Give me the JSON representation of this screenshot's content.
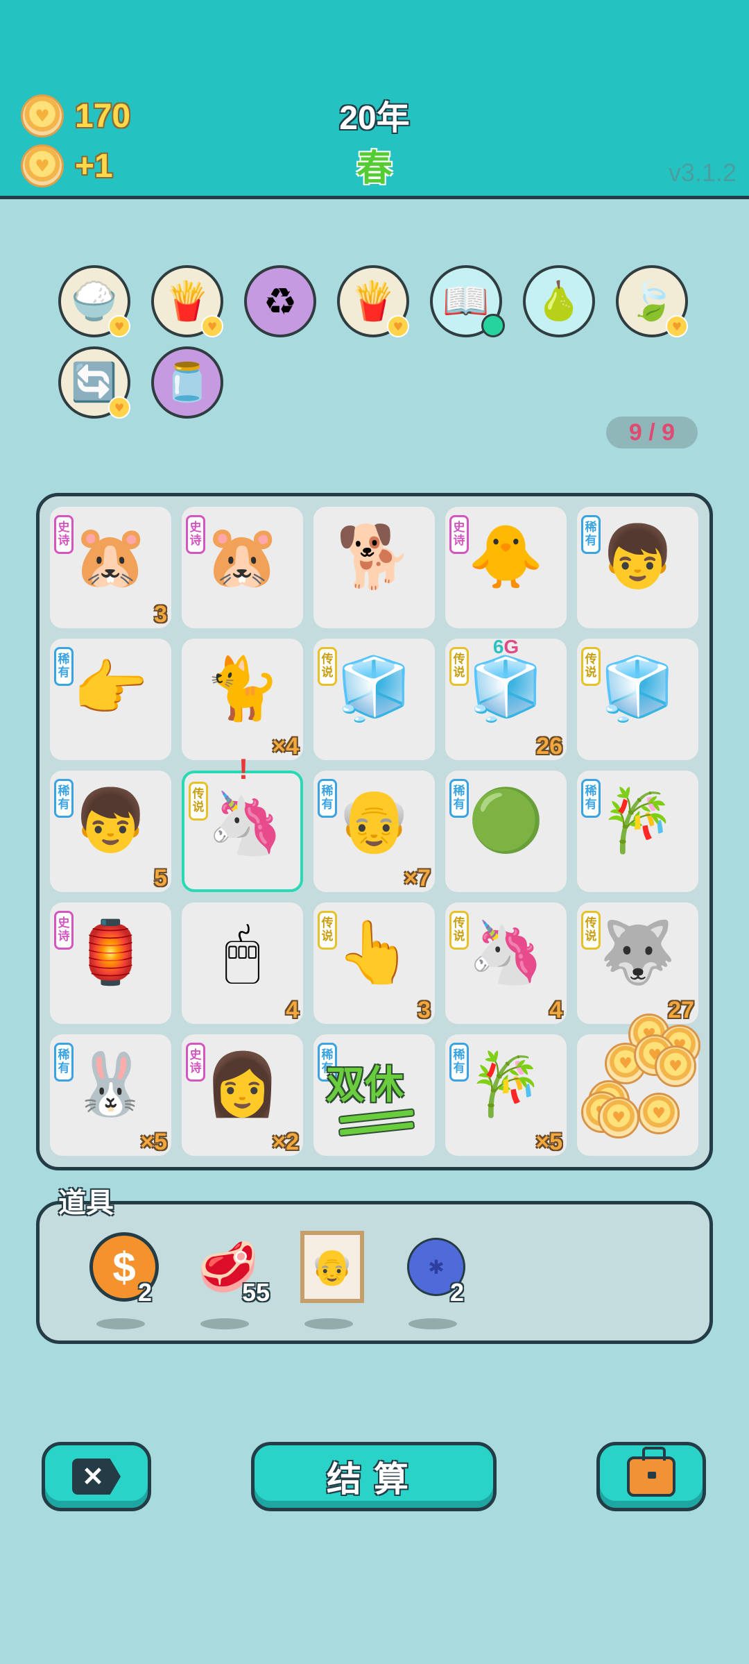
{
  "header": {
    "coins": "170",
    "income": "+1",
    "year": "20年",
    "season": "春",
    "version": "v3.1.2"
  },
  "toolbar": {
    "items": [
      {
        "name": "rice-bowl-icon",
        "glyph": "🍚",
        "style": "beige",
        "badge": "heart"
      },
      {
        "name": "fries-icon",
        "glyph": "🍟",
        "style": "beige",
        "badge": "heart"
      },
      {
        "name": "recycle-icon",
        "glyph": "♻",
        "style": "purple",
        "badge": ""
      },
      {
        "name": "fries-icon",
        "glyph": "🍟",
        "style": "beige",
        "badge": "heart"
      },
      {
        "name": "book-icon",
        "glyph": "📖",
        "style": "cyan",
        "badge": "green-dot"
      },
      {
        "name": "pomelo-icon",
        "glyph": "🍐",
        "style": "cyan",
        "badge": ""
      },
      {
        "name": "leaf-icon",
        "glyph": "🍃",
        "style": "beige",
        "badge": "heart"
      },
      {
        "name": "refresh-icon",
        "glyph": "🔄",
        "style": "beige",
        "badge": "heart"
      },
      {
        "name": "jar-icon",
        "glyph": "🫙",
        "style": "purple",
        "badge": ""
      }
    ]
  },
  "board_counter": "9 / 9",
  "board": {
    "cells": [
      {
        "name": "cell-groundhog",
        "rarity": "史诗",
        "tier": "epic",
        "glyph": "🐹",
        "count": "3"
      },
      {
        "name": "cell-groundhog",
        "rarity": "史诗",
        "tier": "epic",
        "glyph": "🐹",
        "count": ""
      },
      {
        "name": "cell-husky-dog",
        "rarity": "",
        "tier": "",
        "glyph": "🐕",
        "count": ""
      },
      {
        "name": "cell-chick-with-hair",
        "rarity": "史诗",
        "tier": "epic",
        "glyph": "🐥",
        "count": ""
      },
      {
        "name": "cell-boy-face",
        "rarity": "稀有",
        "tier": "rare",
        "glyph": "👦",
        "count": ""
      },
      {
        "name": "cell-pointing-hand",
        "rarity": "稀有",
        "tier": "rare",
        "glyph": "👉",
        "count": ""
      },
      {
        "name": "cell-yellow-cat",
        "rarity": "",
        "tier": "",
        "glyph": "🐈",
        "count": "×4"
      },
      {
        "name": "cell-fridge",
        "rarity": "传说",
        "tier": "legend",
        "glyph": "🧊",
        "count": ""
      },
      {
        "name": "cell-fridge-6g",
        "rarity": "传说",
        "tier": "legend",
        "glyph": "🧊",
        "count": "26",
        "top_badge_a": "6",
        "top_badge_b": "G"
      },
      {
        "name": "cell-fridge",
        "rarity": "传说",
        "tier": "legend",
        "glyph": "🧊",
        "count": ""
      },
      {
        "name": "cell-boy-face",
        "rarity": "稀有",
        "tier": "rare",
        "glyph": "👦",
        "count": "5"
      },
      {
        "name": "cell-unicorn",
        "rarity": "传说",
        "tier": "legend",
        "glyph": "🦄",
        "count": "",
        "selected": true,
        "alert": "!"
      },
      {
        "name": "cell-bald-man",
        "rarity": "稀有",
        "tier": "rare",
        "glyph": "👴",
        "count": "×7"
      },
      {
        "name": "cell-green-ball",
        "rarity": "稀有",
        "tier": "rare",
        "glyph": "🟢",
        "count": ""
      },
      {
        "name": "cell-bamboo",
        "rarity": "稀有",
        "tier": "rare",
        "glyph": "🎋",
        "count": ""
      },
      {
        "name": "cell-rabbit-house",
        "rarity": "史诗",
        "tier": "epic",
        "glyph": "🏮",
        "count": ""
      },
      {
        "name": "cell-mouse",
        "rarity": "",
        "tier": "",
        "glyph": "🖱",
        "count": "4"
      },
      {
        "name": "cell-pointer-hand",
        "rarity": "传说",
        "tier": "legend",
        "glyph": "👆",
        "count": "3"
      },
      {
        "name": "cell-unicorn",
        "rarity": "传说",
        "tier": "legend",
        "glyph": "🦄",
        "count": "4"
      },
      {
        "name": "cell-king-husky",
        "rarity": "传说",
        "tier": "legend",
        "glyph": "🐺",
        "count": "27"
      },
      {
        "name": "cell-moon-rabbit",
        "rarity": "稀有",
        "tier": "rare",
        "glyph": "🐰",
        "count": "×5"
      },
      {
        "name": "cell-girl",
        "rarity": "史诗",
        "tier": "epic",
        "glyph": "👩",
        "count": "×2"
      },
      {
        "name": "cell-double-rest",
        "rarity": "稀有",
        "tier": "rare",
        "glyph": "",
        "count": "",
        "big_text": "双休"
      },
      {
        "name": "cell-bamboo",
        "rarity": "稀有",
        "tier": "rare",
        "glyph": "🎋",
        "count": "×5"
      },
      {
        "name": "cell-coin-pile",
        "rarity": "",
        "tier": "",
        "glyph": "",
        "count": "",
        "coins": true
      }
    ]
  },
  "props": {
    "title": "道具",
    "items": [
      {
        "name": "dollar-coin-icon",
        "kind": "dollar",
        "glyph": "$",
        "qty": "2"
      },
      {
        "name": "liver-icon",
        "kind": "emoji",
        "glyph": "🥩",
        "qty": "55"
      },
      {
        "name": "portrait-frame-icon",
        "kind": "frame",
        "glyph": "👴",
        "qty": ""
      },
      {
        "name": "blueberry-icon",
        "kind": "berry",
        "glyph": "✱",
        "qty": "2"
      }
    ]
  },
  "buttons": {
    "close_glyph": "✕",
    "settle_label": "结算"
  },
  "colors": {
    "top_bar": "#24c2c0",
    "background": "#a8dade",
    "coin_text": "#ffd94a",
    "season_text": "#55cc33",
    "epic": "#d356c0",
    "rare": "#3aa3e2",
    "legend": "#e6c228",
    "selected_border": "#2ad8b5"
  }
}
